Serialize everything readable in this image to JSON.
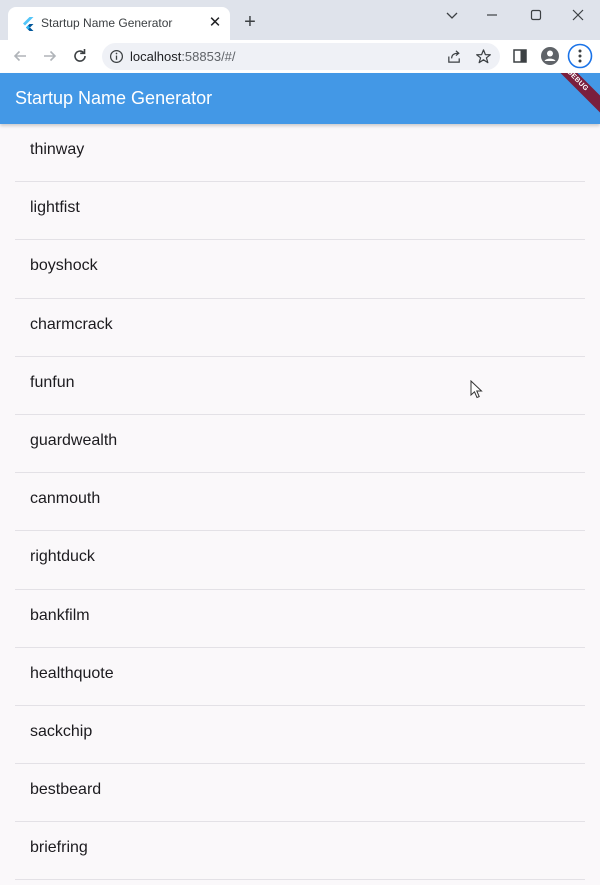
{
  "browser": {
    "tab": {
      "title": "Startup Name Generator",
      "close_glyph": "✕"
    },
    "new_tab_glyph": "+",
    "address": {
      "host": "localhost",
      "rest": ":58853/#/"
    }
  },
  "app": {
    "title": "Startup Name Generator",
    "debug_banner": "DEBUG",
    "colors": {
      "appbar": "#4398e6",
      "banner": "#7a1f3d"
    }
  },
  "list": {
    "items": [
      {
        "label": "thinway"
      },
      {
        "label": "lightfist"
      },
      {
        "label": "boyshock"
      },
      {
        "label": "charmcrack"
      },
      {
        "label": "funfun"
      },
      {
        "label": "guardwealth"
      },
      {
        "label": "canmouth"
      },
      {
        "label": "rightduck"
      },
      {
        "label": "bankfilm"
      },
      {
        "label": "healthquote"
      },
      {
        "label": "sackchip"
      },
      {
        "label": "bestbeard"
      },
      {
        "label": "briefring"
      }
    ]
  }
}
